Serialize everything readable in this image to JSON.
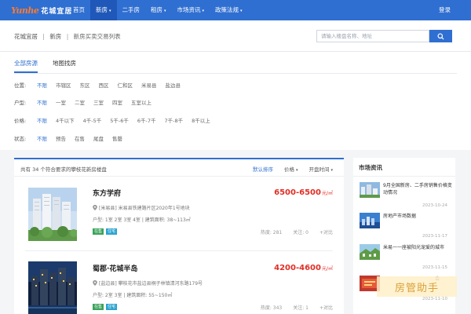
{
  "nav": {
    "logo_mark": "Yunhe",
    "logo_text": "花城宜居",
    "links": [
      {
        "label": "首页"
      },
      {
        "label": "新房",
        "caret": "▾"
      },
      {
        "label": "二手房"
      },
      {
        "label": "租房",
        "caret": "▾"
      },
      {
        "label": "市场资讯",
        "caret": "▾"
      },
      {
        "label": "政策法规",
        "caret": "▾"
      }
    ],
    "login": "登录"
  },
  "breadcrumb": {
    "items": [
      "花城宜居",
      "新房",
      "新房买卖交易列表"
    ],
    "sep": "|"
  },
  "search": {
    "placeholder": "请输入楼盘名称、地址"
  },
  "tabs": [
    "全部房源",
    "地图找房"
  ],
  "filters": [
    {
      "label": "位置:",
      "options": [
        "不限",
        "市辖区",
        "东区",
        "西区",
        "仁和区",
        "米易县",
        "盐边县"
      ]
    },
    {
      "label": "户型:",
      "options": [
        "不限",
        "一室",
        "二室",
        "三室",
        "四室",
        "五室以上"
      ]
    },
    {
      "label": "价格:",
      "options": [
        "不限",
        "4千以下",
        "4千-5千",
        "5千-6千",
        "6千-7千",
        "7千-8千",
        "8千以上"
      ]
    },
    {
      "label": "状态:",
      "options": [
        "不限",
        "预告",
        "在售",
        "尾盘",
        "售罄"
      ]
    }
  ],
  "list": {
    "count_text": "共有 34 个符合要求的攀枝花新房楼盘",
    "sorts": [
      {
        "label": "默认排序",
        "active": true
      },
      {
        "label": "价格",
        "caret": "▾"
      },
      {
        "label": "开盘时间",
        "caret": "▾"
      }
    ],
    "items": [
      {
        "name": "东方学府",
        "price": "6500-6500",
        "unit": "元/㎡",
        "address": "[米易县] 米易县铁建路片区2020年1号地块",
        "spec": "户型: 1室 2室 3室 4室 | 建筑面积: 38~113㎡",
        "tags": [
          "在售",
          "住宅"
        ],
        "views": "热度: 281",
        "follows": "关注: 0",
        "compare": "+对比"
      },
      {
        "name": "蜀郡·花城半岛",
        "price": "4200-4600",
        "unit": "元/㎡",
        "address": "[盐边县] 攀枝花市盐边县桐子林镇清河东路179号",
        "spec": "户型: 2室 3室 | 建筑面积: 55~150㎡",
        "tags": [
          "在售",
          "住宅"
        ],
        "views": "热度: 343",
        "follows": "关注: 1",
        "compare": "+对比"
      }
    ]
  },
  "news": {
    "title": "市场资讯",
    "items": [
      {
        "title": "9月全国新房、二手房销售价格变动情况",
        "date": "2023-10-24"
      },
      {
        "title": "房地产市场数据",
        "date": "2023-11-17"
      },
      {
        "title": "米易一一座被阳光宠爱的城市",
        "date": "2023-11-15"
      },
      {
        "title": "会",
        "date": "2023-11-10"
      }
    ]
  },
  "watermark": "房管助手",
  "colors": {
    "primary": "#2f6fd1",
    "price": "#e02e24",
    "logo_accent": "#ff7a2e",
    "tag_green": "#3aa35a",
    "tag_blue": "#2aa3d0"
  }
}
